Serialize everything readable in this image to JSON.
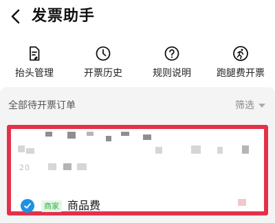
{
  "header": {
    "title": "发票助手"
  },
  "actions": [
    {
      "label": "抬头管理",
      "icon": "document-edit-icon"
    },
    {
      "label": "开票历史",
      "icon": "clock-icon"
    },
    {
      "label": "规则说明",
      "icon": "help-circle-icon"
    },
    {
      "label": "跑腿费开票",
      "icon": "runner-icon"
    }
  ],
  "section": {
    "title": "全部待开票订单",
    "filter_label": "筛选"
  },
  "order": {
    "date_partial": "20",
    "tag": "商家",
    "item_name": "商品费",
    "checked": true
  },
  "colors": {
    "highlight": "#e5304a",
    "accent": "#1e90e6",
    "tag_green": "#2daf48"
  }
}
